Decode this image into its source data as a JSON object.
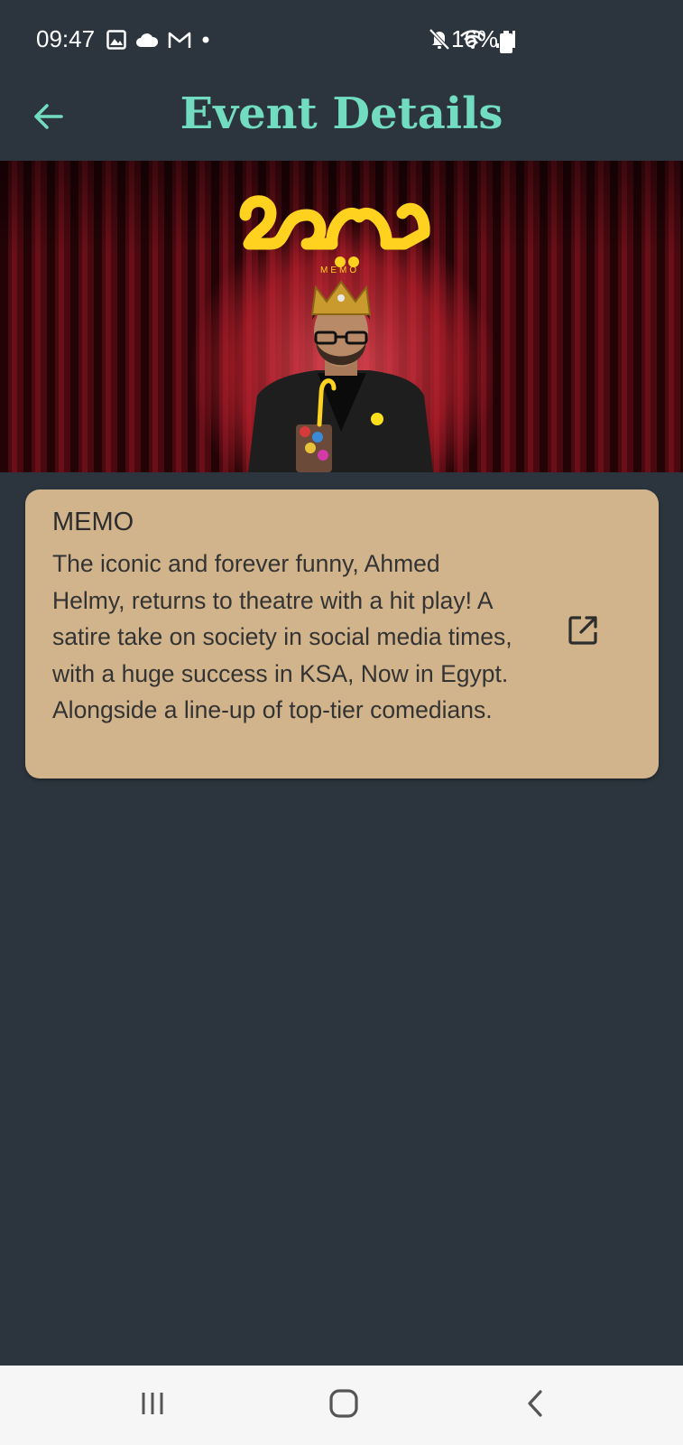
{
  "status_bar": {
    "time": "09:47",
    "battery": "16%",
    "left_icons": [
      "image-icon",
      "cloud-icon",
      "gmail-icon",
      "dot-icon"
    ],
    "right_icons": [
      "mute-icon",
      "wifi-icon",
      "signal-icon",
      "battery-icon"
    ]
  },
  "app_bar": {
    "title": "Event Details",
    "back_icon": "arrow-left-icon",
    "accent_color": "#72dcc0"
  },
  "banner": {
    "logo_sub": "MEMO"
  },
  "event": {
    "name": "MEMO",
    "description": "The iconic and forever funny, Ahmed Helmy, returns to theatre with a hit play! A satire take on society in social media times, with a huge success in KSA, Now in Egypt. Alongside a line-up of top-tier comedians.",
    "link_icon": "open-in-new-icon",
    "card_color": "#d2b48c"
  },
  "nav_bar": {
    "buttons": [
      "recents-icon",
      "home-icon",
      "back-icon"
    ]
  },
  "colors": {
    "background": "#2c353e"
  }
}
